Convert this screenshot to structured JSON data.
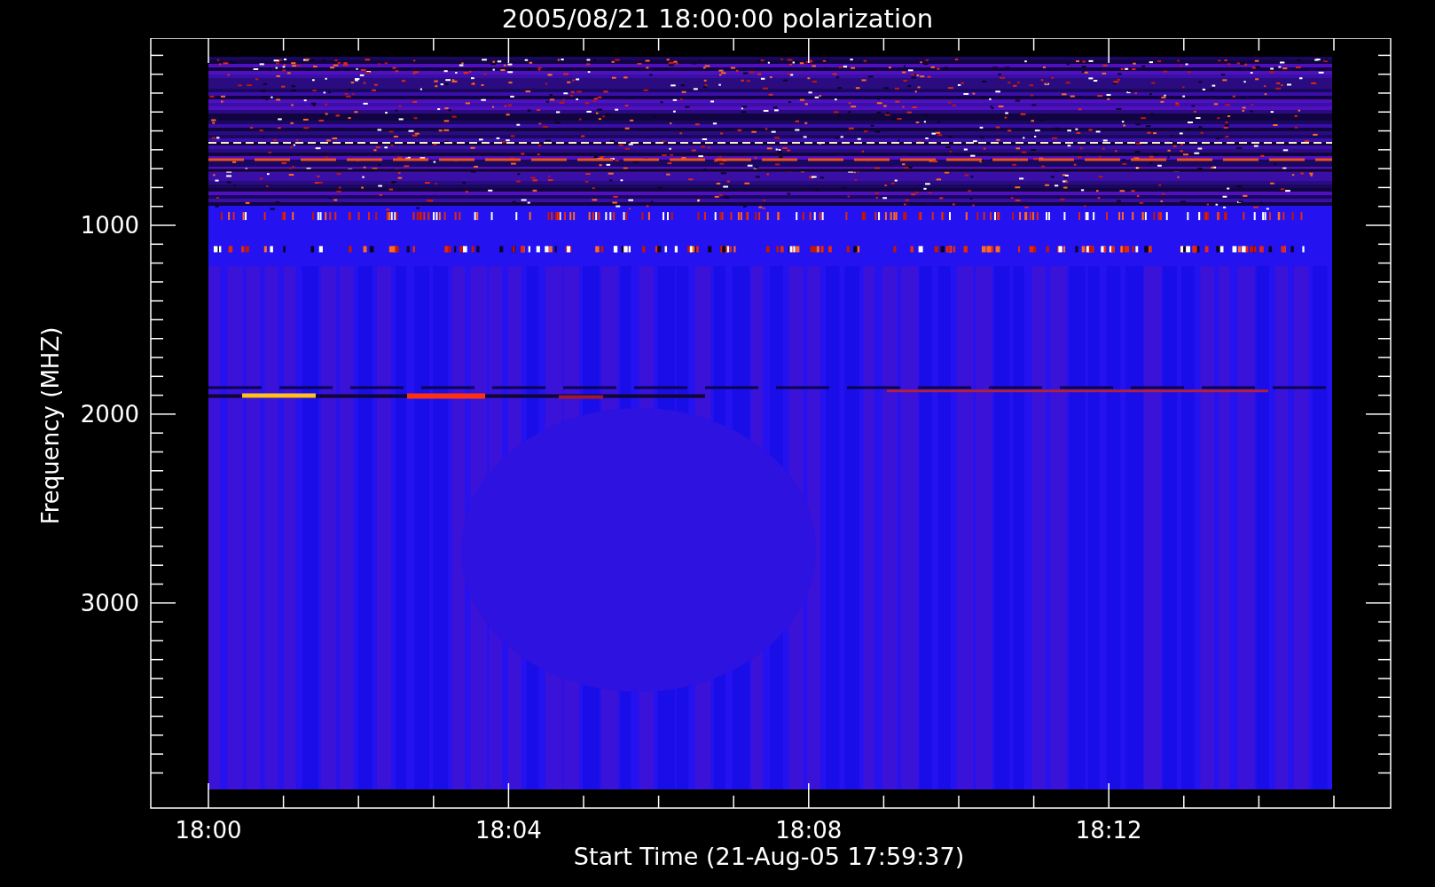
{
  "title": "2005/08/21 18:00:00 polarization",
  "x_axis": {
    "label": "Start Time (21-Aug-05 17:59:37)",
    "ticks": [
      "18:00",
      "18:04",
      "18:08",
      "18:12"
    ]
  },
  "y_axis": {
    "label": "Frequency (MHZ)",
    "ticks": [
      "1000",
      "2000",
      "3000"
    ]
  }
}
